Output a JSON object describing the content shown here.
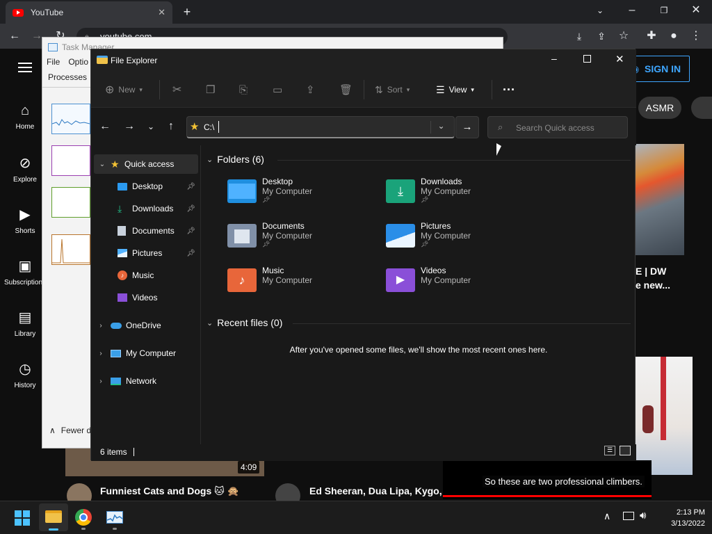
{
  "chrome": {
    "tab_title": "YouTube",
    "url": "youtube.com",
    "new_tab_icon": "plus-icon"
  },
  "youtube": {
    "sign_in": "SIGN IN",
    "chip": "ASMR",
    "sidebar": [
      {
        "label": "Home",
        "icon": "home-icon"
      },
      {
        "label": "Explore",
        "icon": "compass-icon"
      },
      {
        "label": "Shorts",
        "icon": "shorts-icon"
      },
      {
        "label": "Subscriptions",
        "icon": "subscriptions-icon"
      },
      {
        "label": "Library",
        "icon": "library-icon"
      },
      {
        "label": "History",
        "icon": "history-icon"
      }
    ],
    "video_title_1": "Funniest Cats and Dogs 🐱 🙊",
    "duration_1": "4:09",
    "video_title_2": "Ed Sheeran, Dua Lipa, Kygo, Av",
    "right_title_a": "E | DW",
    "right_title_b": "e new...",
    "caption": "So these are two professional climbers."
  },
  "taskmgr": {
    "title": "Task Manager",
    "menu": [
      "File",
      "Optio"
    ],
    "tab": "Processes",
    "fewer": "Fewer d"
  },
  "explorer": {
    "title": "File Explorer",
    "toolbar": {
      "new": "New",
      "sort": "Sort",
      "view": "View"
    },
    "address": "C:\\",
    "search_placeholder": "Search Quick access",
    "nav": {
      "quick_access": "Quick access",
      "pinned": [
        "Desktop",
        "Downloads",
        "Documents",
        "Pictures"
      ],
      "unpinned": [
        "Music",
        "Videos"
      ],
      "onedrive": "OneDrive",
      "my_computer": "My Computer",
      "network": "Network"
    },
    "folders_header": "Folders (6)",
    "folders": [
      {
        "name": "Desktop",
        "loc": "My Computer",
        "pinned": true,
        "color": "#1f8fe0"
      },
      {
        "name": "Downloads",
        "loc": "My Computer",
        "pinned": true,
        "color": "#1aa37a"
      },
      {
        "name": "Documents",
        "loc": "My Computer",
        "pinned": true,
        "color": "#8090a8"
      },
      {
        "name": "Pictures",
        "loc": "My Computer",
        "pinned": true,
        "color": "#2a8ee8"
      },
      {
        "name": "Music",
        "loc": "My Computer",
        "pinned": false,
        "color": "#e8663a"
      },
      {
        "name": "Videos",
        "loc": "My Computer",
        "pinned": false,
        "color": "#8a4fd8"
      }
    ],
    "recent_header": "Recent files (0)",
    "recent_empty": "After you've opened some files, we'll show the most recent ones here.",
    "status": "6 items"
  },
  "taskbar": {
    "time": "2:13 PM",
    "date": "3/13/2022"
  }
}
